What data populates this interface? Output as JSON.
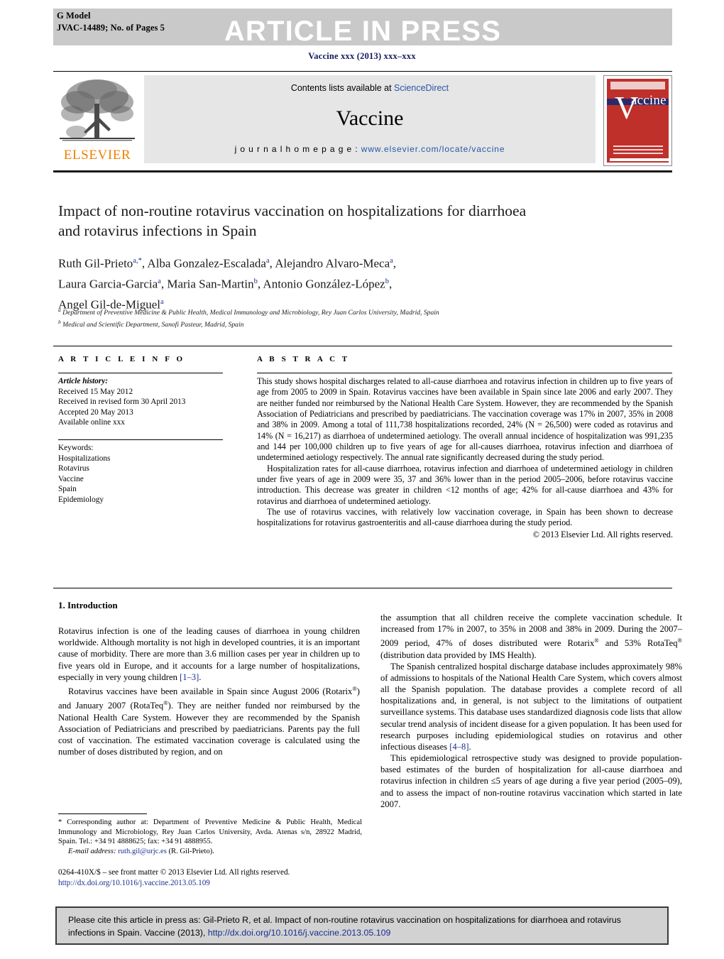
{
  "header": {
    "g_model": "G Model",
    "article_id": "JVAC-14489;   No. of Pages 5",
    "banner": "ARTICLE IN PRESS",
    "journal_ref": "Vaccine xxx (2013) xxx–xxx"
  },
  "masthead": {
    "elsevier_label": "ELSEVIER",
    "contents_prefix": "Contents lists available at ",
    "contents_link": "ScienceDirect",
    "journal_title": "Vaccine",
    "homepage_prefix": "j o u r n a l   h o m e p a g e :  ",
    "homepage_url": "www.elsevier.com/locate/vaccine",
    "cover_title": "accine",
    "cover_v": "V"
  },
  "article": {
    "title": "Impact of non-routine rotavirus vaccination on hospitalizations for diarrhoea and rotavirus infections in Spain",
    "authors_line1_a": "Ruth Gil-Prieto",
    "authors_line1_a_sup": "a,*",
    "authors_line1_b": ", Alba Gonzalez-Escalada",
    "authors_line1_b_sup": "a",
    "authors_line1_c": ", Alejandro Alvaro-Meca",
    "authors_line1_c_sup": "a",
    "authors_line1_end": ",",
    "authors_line2_a": "Laura Garcia-Garcia",
    "authors_line2_a_sup": "a",
    "authors_line2_b": ", Maria San-Martin",
    "authors_line2_b_sup": "b",
    "authors_line2_c": ", Antonio González-López",
    "authors_line2_c_sup": "b",
    "authors_line2_end": ",",
    "authors_line3_a": "Angel Gil-de-Miguel",
    "authors_line3_a_sup": "a",
    "affiliation_a_sup": "a",
    "affiliation_a": " Department of Preventive Medicine & Public Health, Medical Immunology and Microbiology, Rey Juan Carlos University, Madrid, Spain",
    "affiliation_b_sup": "b",
    "affiliation_b": " Medical and Scientific Department, Sanofi Pasteur, Madrid, Spain"
  },
  "article_info": {
    "heading": "A R T I C L E    I N F O",
    "history_label": "Article history:",
    "received": "Received 15 May 2012",
    "revised": "Received in revised form 30 April 2013",
    "accepted": "Accepted 20 May 2013",
    "online": "Available online xxx",
    "keywords_label": "Keywords:",
    "keywords": [
      "Hospitalizations",
      "Rotavirus",
      "Vaccine",
      "Spain",
      "Epidemiology"
    ]
  },
  "abstract": {
    "heading": "A B S T R A C T",
    "paragraph1": "This study shows hospital discharges related to all-cause diarrhoea and rotavirus infection in children up to five years of age from 2005 to 2009 in Spain. Rotavirus vaccines have been available in Spain since late 2006 and early 2007. They are neither funded nor reimbursed by the National Health Care System. However, they are recommended by the Spanish Association of Pediatricians and prescribed by paediatricians. The vaccination coverage was 17% in 2007, 35% in 2008 and 38% in 2009. Among a total of 111,738 hospitalizations recorded, 24% (N = 26,500) were coded as rotavirus and 14% (N = 16,217) as diarrhoea of undetermined aetiology. The overall annual incidence of hospitalization was 991,235 and 144 per 100,000 children up to five years of age for all-causes diarrhoea, rotavirus infection and diarrhoea of undetermined aetiology respectively. The annual rate significantly decreased during the study period.",
    "paragraph2": "Hospitalization rates for all-cause diarrhoea, rotavirus infection and diarrhoea of undetermined aetiology in children under five years of age in 2009 were 35, 37 and 36% lower than in the period 2005–2006, before rotavirus vaccine introduction. This decrease was greater in children <12 months of age; 42% for all-cause diarrhoea and 43% for rotavirus and diarrhoea of undetermined aetiology.",
    "paragraph3": "The use of rotavirus vaccines, with relatively low vaccination coverage, in Spain has been shown to decrease hospitalizations for rotavirus gastroenteritis and all-cause diarrhoea during the study period.",
    "copyright": "© 2013 Elsevier Ltd. All rights reserved."
  },
  "introduction": {
    "heading": "1.  Introduction",
    "left_p1_a": "Rotavirus infection is one of the leading causes of diarrhoea in young children worldwide. Although mortality is not high in developed countries, it is an important cause of morbidity. There are more than 3.6 million cases per year in children up to five years old in Europe, and it accounts for a large number of hospitalizations, especially in very young children ",
    "left_p1_ref": "[1–3]",
    "left_p1_b": ".",
    "left_p2_a": "Rotavirus vaccines have been available in Spain since August 2006 (Rotarix",
    "left_p2_reg1": "®",
    "left_p2_b": ") and January 2007 (RotaTeq",
    "left_p2_reg2": "®",
    "left_p2_c": "). They are neither funded nor reimbursed by the National Health Care System. However they are recommended by the Spanish Association of Pediatricians and prescribed by paediatricians. Parents pay the full cost of vaccination. The estimated vaccination coverage is calculated using the number of doses distributed by region, and on",
    "right_p1_a": "the assumption that all children receive the complete vaccination schedule. It increased from 17% in 2007, to 35% in 2008 and 38% in 2009. During the 2007–2009 period, 47% of doses distributed were Rotarix",
    "right_p1_reg1": "®",
    "right_p1_b": " and 53% RotaTeq",
    "right_p1_reg2": "®",
    "right_p1_c": " (distribution data provided by IMS Health).",
    "right_p2_a": "The Spanish centralized hospital discharge database includes approximately 98% of admissions to hospitals of the National Health Care System, which covers almost all the Spanish population. The database provides a complete record of all hospitalizations and, in general, is not subject to the limitations of outpatient surveillance systems. This database uses standardized diagnosis code lists that allow secular trend analysis of incident disease for a given population. It has been used for research purposes including epidemiological studies on rotavirus and other infectious diseases ",
    "right_p2_ref": "[4–8]",
    "right_p2_b": ".",
    "right_p3": "This epidemiological retrospective study was designed to provide population-based estimates of the burden of hospitalization for all-cause diarrhoea and rotavirus infection in children ≤5 years of age during a five year period (2005–09), and to assess the impact of non-routine rotavirus vaccination which started in late 2007."
  },
  "footnotes": {
    "corresponding_star": "*",
    "corresponding": " Corresponding author at: Department of Preventive Medicine & Public Health, Medical Immunology and Microbiology, Rey Juan Carlos University, Avda. Atenas s/n, 28922 Madrid, Spain. Tel.: +34 91 4888625; fax: +34 91 4888955.",
    "email_label": "E-mail address:",
    "email": "ruth.gil@urjc.es",
    "email_owner": " (R. Gil-Prieto).",
    "front_matter": "0264-410X/$ – see front matter © 2013 Elsevier Ltd. All rights reserved.",
    "doi": "http://dx.doi.org/10.1016/j.vaccine.2013.05.109"
  },
  "cite_box": {
    "text_a": "Please cite this article in press as: Gil-Prieto R, et al. Impact of non-routine rotavirus vaccination on hospitalizations for diarrhoea and rotavirus infections in Spain. Vaccine (2013), ",
    "link": "http://dx.doi.org/10.1016/j.vaccine.2013.05.109"
  },
  "colors": {
    "link_blue": "#2456a8",
    "ref_blue": "#1b2f8f",
    "elsevier_orange": "#f08000",
    "cover_red": "#c0302b",
    "banner_gray": "#c9c9c9"
  }
}
